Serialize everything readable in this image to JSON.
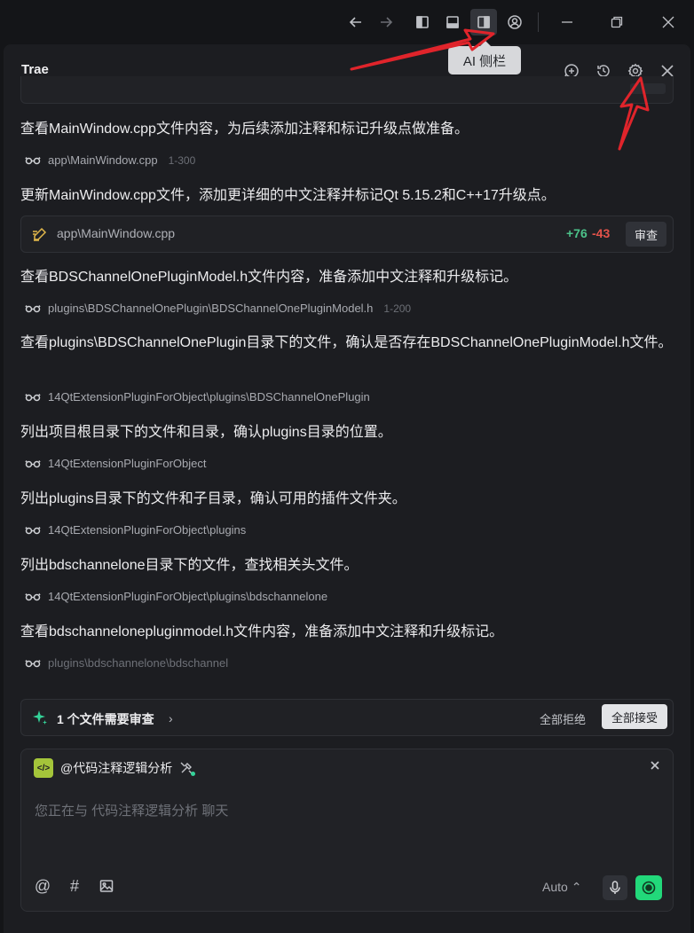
{
  "titlebar": {
    "icons": [
      "back-arrow-icon",
      "forward-arrow-icon",
      "left-sidebar-icon",
      "bottom-panel-icon",
      "right-sidebar-icon",
      "account-icon",
      "minimize-icon",
      "restore-icon",
      "close-icon"
    ],
    "tooltip": "AI 侧栏"
  },
  "panel": {
    "title": "Trae",
    "header_icons": [
      "new-chat-icon",
      "history-icon",
      "settings-icon",
      "close-icon"
    ]
  },
  "steps": [
    {
      "title": "查看MainWindow.cpp文件内容，为后续添加注释和标记升级点做准备。",
      "ref": "app\\MainWindow.cpp",
      "range": "1-300"
    },
    {
      "title": "更新MainWindow.cpp文件，添加更详细的中文注释并标记Qt 5.15.2和C++17升级点。"
    },
    {
      "title": "查看BDSChannelOnePluginModel.h文件内容，准备添加中文注释和升级标记。",
      "ref": "plugins\\BDSChannelOnePlugin\\BDSChannelOnePluginModel.h",
      "range": "1-200"
    },
    {
      "title": "查看plugins\\BDSChannelOnePlugin目录下的文件，确认是否存在BDSChannelOnePluginModel.h文件。",
      "ref": "14QtExtensionPluginForObject\\plugins\\BDSChannelOnePlugin"
    },
    {
      "title": "列出项目根目录下的文件和目录，确认plugins目录的位置。",
      "ref": "14QtExtensionPluginForObject"
    },
    {
      "title": "列出plugins目录下的文件和子目录，确认可用的插件文件夹。",
      "ref": "14QtExtensionPluginForObject\\plugins"
    },
    {
      "title": "列出bdschannelone目录下的文件，查找相关头文件。",
      "ref": "14QtExtensionPluginForObject\\plugins\\bdschannelone"
    },
    {
      "title": "查看bdschannelonepluginmodel.h文件内容，准备添加中文注释和升级标记。",
      "ref": "plugins\\bdschannelone\\bdschannel"
    }
  ],
  "file_change": {
    "file": "app\\MainWindow.cpp",
    "additions": "+76",
    "deletions": "-43",
    "review_label": "审查"
  },
  "review_bar": {
    "label": "1 个文件需要审查",
    "reject_all": "全部拒绝",
    "accept_all": "全部接受"
  },
  "input": {
    "agent_logo": "</>",
    "agent_name": "@代码注释逻辑分析",
    "placeholder": "您正在与 代码注释逻辑分析 聊天",
    "model": "Auto",
    "tools": [
      "@",
      "#"
    ]
  },
  "colors": {
    "background": "#141518",
    "panel": "#1c1d21",
    "accent_green": "#22d87a",
    "additions": "#4cc38a",
    "deletions": "#e5534b",
    "annotation_red": "#e0242b"
  }
}
